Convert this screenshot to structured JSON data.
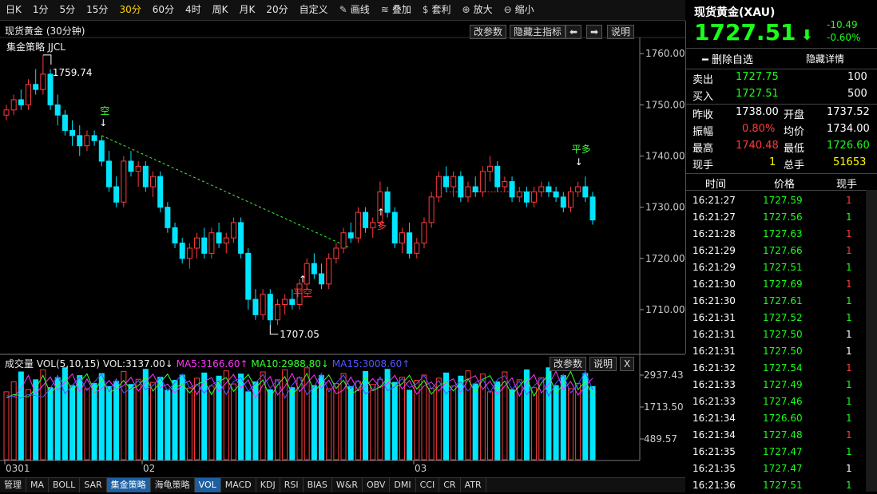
{
  "toolbar": {
    "periods": [
      "日K",
      "1分",
      "5分",
      "15分",
      "30分",
      "60分",
      "4时",
      "周K",
      "月K",
      "20分",
      "自定义"
    ],
    "active_period": "30分",
    "tools": [
      {
        "label": "画线",
        "icon": "pen-icon"
      },
      {
        "label": "叠加",
        "icon": "stack-icon"
      },
      {
        "label": "套利",
        "icon": "money-bag-icon"
      },
      {
        "label": "放大",
        "icon": "zoom-in-icon"
      },
      {
        "label": "缩小",
        "icon": "zoom-out-icon"
      }
    ]
  },
  "chart": {
    "title": "现货黄金 (30分钟)",
    "strategy": "集金策略 JJCL",
    "buttons": {
      "params": "改参数",
      "hide": "隐藏主指标",
      "left": "⬅",
      "right": "➡",
      "help": "说明"
    },
    "price_axis": [
      "1760.00",
      "1750.00",
      "1740.00",
      "1730.00",
      "1720.00",
      "1710.00"
    ],
    "high_label": "1759.74",
    "low_label": "1707.05",
    "signals": {
      "short": "空",
      "long": "多",
      "close_short": "平空",
      "close_long": "平多"
    },
    "date_labels": [
      "0301",
      "02",
      "03"
    ]
  },
  "chart_data": {
    "type": "candlestick",
    "title": "现货黄金 (30分钟)",
    "ylim": [
      1705,
      1763
    ],
    "high": 1759.74,
    "low": 1707.05,
    "candles": [
      [
        1748,
        1750,
        1747,
        1749
      ],
      [
        1749,
        1752,
        1748,
        1751
      ],
      [
        1751,
        1753,
        1749,
        1750
      ],
      [
        1750,
        1755,
        1749,
        1754
      ],
      [
        1754,
        1757,
        1752,
        1753
      ],
      [
        1753,
        1759.74,
        1752,
        1756
      ],
      [
        1756,
        1757,
        1749,
        1750
      ],
      [
        1750,
        1752,
        1746,
        1748
      ],
      [
        1748,
        1749,
        1744,
        1745
      ],
      [
        1745,
        1747,
        1742,
        1744
      ],
      [
        1744,
        1746,
        1740,
        1742
      ],
      [
        1742,
        1745,
        1741,
        1744
      ],
      [
        1744,
        1745,
        1742,
        1743
      ],
      [
        1743,
        1744,
        1738,
        1739
      ],
      [
        1739,
        1741,
        1733,
        1734
      ],
      [
        1734,
        1736,
        1730,
        1731
      ],
      [
        1731,
        1740,
        1730,
        1739
      ],
      [
        1739,
        1741,
        1736,
        1737
      ],
      [
        1737,
        1739,
        1734,
        1738
      ],
      [
        1738,
        1739,
        1733,
        1734
      ],
      [
        1734,
        1737,
        1732,
        1736
      ],
      [
        1736,
        1737,
        1729,
        1730
      ],
      [
        1730,
        1731,
        1725,
        1726
      ],
      [
        1726,
        1727,
        1722,
        1723
      ],
      [
        1723,
        1724,
        1719,
        1720
      ],
      [
        1720,
        1723,
        1718,
        1722
      ],
      [
        1722,
        1725,
        1720,
        1724
      ],
      [
        1724,
        1726,
        1720,
        1721
      ],
      [
        1721,
        1726,
        1720,
        1725
      ],
      [
        1725,
        1727,
        1722,
        1723
      ],
      [
        1723,
        1725,
        1721,
        1724
      ],
      [
        1724,
        1728,
        1723,
        1727
      ],
      [
        1727,
        1728,
        1720,
        1721
      ],
      [
        1721,
        1722,
        1710,
        1712
      ],
      [
        1712,
        1714,
        1708,
        1709
      ],
      [
        1709,
        1714,
        1708,
        1713
      ],
      [
        1713,
        1714,
        1707.05,
        1708
      ],
      [
        1708,
        1712,
        1707,
        1711
      ],
      [
        1711,
        1713,
        1709,
        1712
      ],
      [
        1712,
        1714,
        1710,
        1711
      ],
      [
        1711,
        1716,
        1710,
        1715
      ],
      [
        1715,
        1720,
        1714,
        1719
      ],
      [
        1719,
        1721,
        1716,
        1717
      ],
      [
        1717,
        1719,
        1714,
        1715
      ],
      [
        1715,
        1721,
        1714,
        1720
      ],
      [
        1720,
        1723,
        1719,
        1722
      ],
      [
        1722,
        1726,
        1721,
        1725
      ],
      [
        1725,
        1727,
        1723,
        1724
      ],
      [
        1724,
        1730,
        1723,
        1729
      ],
      [
        1729,
        1730,
        1725,
        1726
      ],
      [
        1726,
        1728,
        1724,
        1727
      ],
      [
        1727,
        1735,
        1726,
        1733
      ],
      [
        1733,
        1734,
        1728,
        1729
      ],
      [
        1729,
        1730,
        1722,
        1723
      ],
      [
        1723,
        1726,
        1721,
        1725
      ],
      [
        1725,
        1727,
        1720,
        1721
      ],
      [
        1721,
        1724,
        1720,
        1723
      ],
      [
        1723,
        1728,
        1722,
        1727
      ],
      [
        1727,
        1733,
        1726,
        1732
      ],
      [
        1732,
        1737,
        1731,
        1736
      ],
      [
        1736,
        1738,
        1733,
        1734
      ],
      [
        1734,
        1737,
        1732,
        1736
      ],
      [
        1736,
        1737,
        1731,
        1732
      ],
      [
        1732,
        1735,
        1731,
        1734
      ],
      [
        1734,
        1736,
        1732,
        1733
      ],
      [
        1733,
        1738,
        1732,
        1737
      ],
      [
        1737,
        1740,
        1735,
        1738
      ],
      [
        1738,
        1739,
        1733,
        1734
      ],
      [
        1734,
        1736,
        1733,
        1735
      ],
      [
        1735,
        1736,
        1731,
        1732
      ],
      [
        1732,
        1734,
        1731,
        1733
      ],
      [
        1733,
        1734,
        1730,
        1731
      ],
      [
        1731,
        1734,
        1730,
        1733
      ],
      [
        1733,
        1735,
        1732,
        1734
      ],
      [
        1734,
        1735,
        1732,
        1733
      ],
      [
        1733,
        1734,
        1731,
        1732
      ],
      [
        1732,
        1733,
        1729,
        1730
      ],
      [
        1730,
        1734,
        1729,
        1733
      ],
      [
        1733,
        1735,
        1732,
        1734
      ],
      [
        1734,
        1736,
        1731,
        1732
      ],
      [
        1732,
        1733,
        1726.6,
        1727.51
      ]
    ],
    "volume": {
      "label": "成交量 VOL(5,10,15) VOL:3137.00",
      "ma5": "MA5:3166.60",
      "ma10": "MA10:2988.80",
      "ma15": "MA15:3008.60",
      "axis": [
        "2937.43",
        "1713.50",
        "489.57"
      ]
    }
  },
  "bottom_tabs": [
    "管理",
    "MA",
    "BOLL",
    "SAR",
    "集金策略",
    "海龟策略",
    "VOL",
    "MACD",
    "KDJ",
    "RSI",
    "BIAS",
    "W&R",
    "OBV",
    "DMI",
    "CCI",
    "CR",
    "ATR"
  ],
  "bottom_active": [
    "集金策略",
    "VOL"
  ],
  "quote": {
    "name": "现货黄金(XAU)",
    "price": "1727.51",
    "change": "-10.49",
    "change_pct": "-0.60%",
    "delete_watch": "删除自选",
    "hide_detail": "隐藏详情",
    "sell_label": "卖出",
    "sell_price": "1727.75",
    "sell_vol": "100",
    "buy_label": "买入",
    "buy_price": "1727.51",
    "buy_vol": "500",
    "prev_close_label": "昨收",
    "prev_close": "1738.00",
    "open_label": "开盘",
    "open": "1737.52",
    "amp_label": "振幅",
    "amp": "0.80%",
    "avg_label": "均价",
    "avg": "1734.00",
    "high_label": "最高",
    "high": "1740.48",
    "low_label": "最低",
    "low": "1726.60",
    "now_hand_label": "现手",
    "now_hand": "1",
    "total_hand_label": "总手",
    "total_hand": "51653"
  },
  "ticks": {
    "headers": [
      "时间",
      "价格",
      "现手"
    ],
    "rows": [
      [
        "16:21:27",
        "1727.59",
        "1"
      ],
      [
        "16:21:27",
        "1727.56",
        "1"
      ],
      [
        "16:21:28",
        "1727.63",
        "1"
      ],
      [
        "16:21:29",
        "1727.66",
        "1"
      ],
      [
        "16:21:29",
        "1727.51",
        "1"
      ],
      [
        "16:21:30",
        "1727.69",
        "1"
      ],
      [
        "16:21:30",
        "1727.61",
        "1"
      ],
      [
        "16:21:31",
        "1727.52",
        "1"
      ],
      [
        "16:21:31",
        "1727.50",
        "1"
      ],
      [
        "16:21:31",
        "1727.50",
        "1"
      ],
      [
        "16:21:32",
        "1727.54",
        "1"
      ],
      [
        "16:21:33",
        "1727.49",
        "1"
      ],
      [
        "16:21:33",
        "1727.46",
        "1"
      ],
      [
        "16:21:34",
        "1726.60",
        "1"
      ],
      [
        "16:21:34",
        "1727.48",
        "1"
      ],
      [
        "16:21:35",
        "1727.47",
        "1"
      ],
      [
        "16:21:35",
        "1727.47",
        "1"
      ],
      [
        "16:21:36",
        "1727.51",
        "1"
      ]
    ],
    "colors": [
      "red",
      "green",
      "red",
      "red",
      "green",
      "red",
      "green",
      "green",
      "white",
      "white",
      "red",
      "green",
      "green",
      "green",
      "red",
      "green",
      "white",
      "green"
    ]
  }
}
